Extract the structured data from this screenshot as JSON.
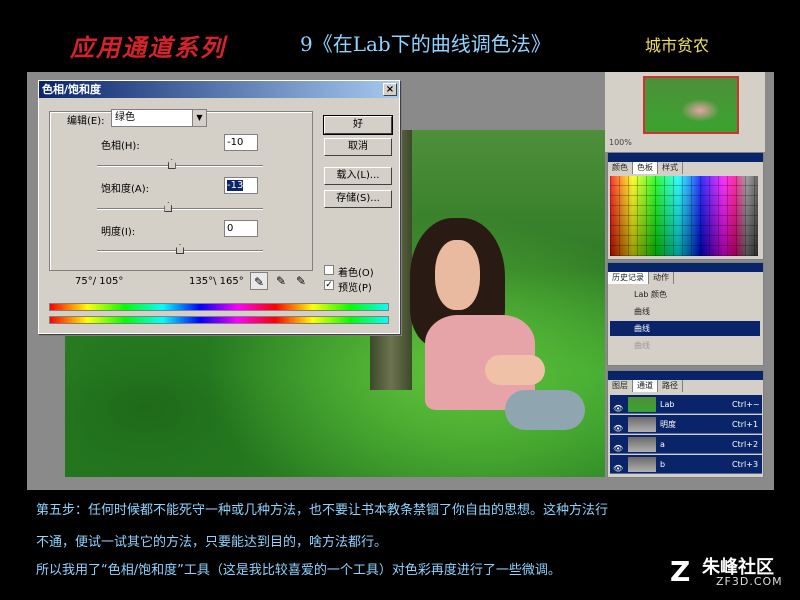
{
  "header": {
    "series_title": "应用通道系列",
    "lesson_title": "9《在Lab下的曲线调色法》",
    "author": "城市贫农"
  },
  "dialog": {
    "title": "色相/饱和度",
    "close": "×",
    "edit_label": "编辑(E):",
    "edit_value": "绿色",
    "hue_label": "色相(H):",
    "hue_value": "-10",
    "hue_level": 0.45,
    "sat_label": "饱和度(A):",
    "sat_value": "-13",
    "sat_level": 0.43,
    "light_label": "明度(I):",
    "light_value": "0",
    "light_level": 0.5,
    "range_left": "75°/ 105°",
    "range_right": "135°\\ 165°",
    "ok": "好",
    "cancel": "取消",
    "load": "载入(L)...",
    "save": "存储(S)...",
    "colorize_label": "着色(O)",
    "preview_label": "预览(P)",
    "preview_checked": "✓"
  },
  "navigator": {
    "zoom": "100%"
  },
  "swatch_panel": {
    "tabs": [
      "颜色",
      "色板",
      "样式"
    ],
    "active": 1
  },
  "history_panel": {
    "tabs": [
      "历史记录",
      "动作"
    ],
    "items": [
      {
        "label": "Lab 颜色",
        "state": "normal"
      },
      {
        "label": "曲线",
        "state": "normal"
      },
      {
        "label": "曲线",
        "state": "selected"
      },
      {
        "label": "曲线",
        "state": "dim"
      }
    ]
  },
  "channels_panel": {
    "tabs": [
      "图层",
      "通道",
      "路径"
    ],
    "items": [
      {
        "name": "Lab",
        "key": "Ctrl+~"
      },
      {
        "name": "明度",
        "key": "Ctrl+1"
      },
      {
        "name": "a",
        "key": "Ctrl+2"
      },
      {
        "name": "b",
        "key": "Ctrl+3"
      }
    ]
  },
  "caption": {
    "line1": "第五步：任何时候都不能死守一种或几种方法，也不要让书本教条禁锢了你自由的思想。这种方法行",
    "line2": "不通，便试一试其它的方法，只要能达到目的，啥方法都行。",
    "line3": "所以我用了“色相/饱和度”工具（这是我比较喜爱的一个工具）对色彩再度进行了一些微调。"
  },
  "watermark": {
    "cn": "朱峰社区",
    "en": "ZF3D.COM"
  }
}
